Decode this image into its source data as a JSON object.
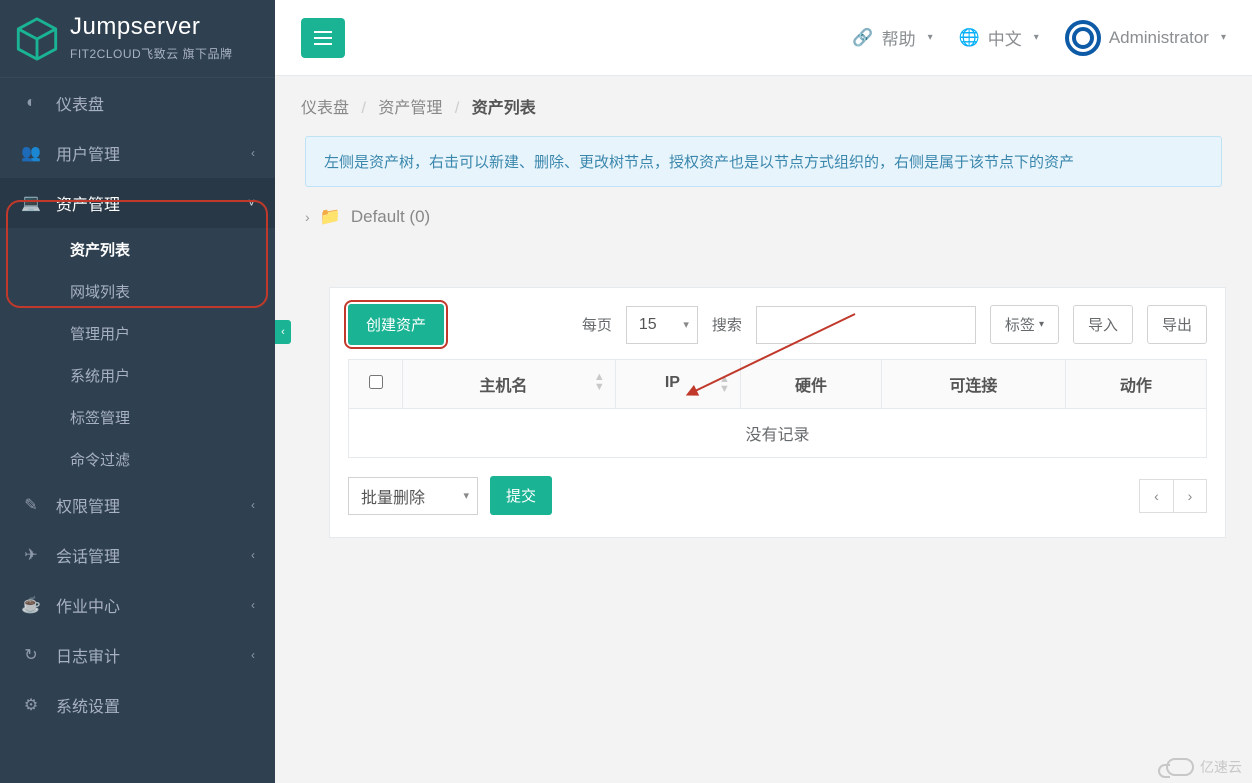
{
  "brand": {
    "title": "Jumpserver",
    "subtitle": "FIT2CLOUD飞致云 旗下品牌"
  },
  "topbar": {
    "help": "帮助",
    "language": "中文",
    "user": "Administrator"
  },
  "sidebar": {
    "dashboard": "仪表盘",
    "users": "用户管理",
    "assets": {
      "label": "资产管理",
      "sub": {
        "asset_list": "资产列表",
        "domain_list": "网域列表",
        "admin_user": "管理用户",
        "system_user": "系统用户",
        "label_mgmt": "标签管理",
        "cmd_filter": "命令过滤"
      }
    },
    "perms": "权限管理",
    "sessions": "会话管理",
    "jobs": "作业中心",
    "audits": "日志审计",
    "settings": "系统设置"
  },
  "breadcrumb": {
    "a": "仪表盘",
    "b": "资产管理",
    "c": "资产列表"
  },
  "info": "左侧是资产树，右击可以新建、删除、更改树节点，授权资产也是以节点方式组织的，右侧是属于该节点下的资产",
  "tree": {
    "root": "Default  (0)"
  },
  "toolbar": {
    "create": "创建资产",
    "perpage_label": "每页",
    "perpage_value": "15",
    "search_label": "搜索",
    "tags": "标签",
    "import": "导入",
    "export": "导出"
  },
  "table": {
    "cols": {
      "host": "主机名",
      "ip": "IP",
      "hw": "硬件",
      "conn": "可连接",
      "action": "动作"
    },
    "empty": "没有记录"
  },
  "footer": {
    "bulk_sel": "批量删除",
    "submit": "提交",
    "prev": "‹",
    "next": "›"
  },
  "watermark": "亿速云"
}
